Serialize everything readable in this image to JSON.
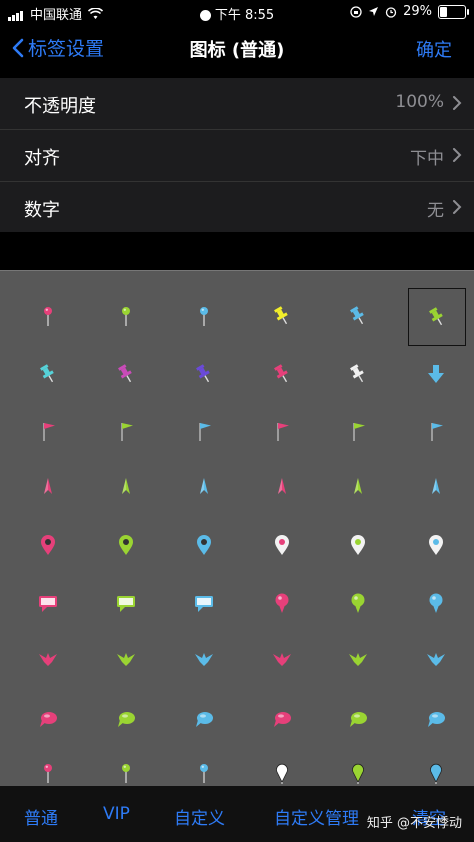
{
  "status_bar": {
    "carrier": "中国联通",
    "time": "下午 8:55",
    "battery": "29%",
    "battery_level": 0.29
  },
  "nav": {
    "back_label": "标签设置",
    "title": "图标 (普通)",
    "confirm_label": "确定"
  },
  "settings": [
    {
      "label": "不透明度",
      "value": "100%"
    },
    {
      "label": "对齐",
      "value": "下中"
    },
    {
      "label": "数字",
      "value": "无"
    }
  ],
  "icons": [
    [
      "pin-red-icon",
      "pin-green-icon",
      "pin-blue-icon",
      "pushpin-yellow-icon",
      "pushpin-blue-icon",
      "pushpin-green-icon"
    ],
    [
      "pushpin-cyan-icon",
      "pushpin-magenta-icon",
      "pushpin-purple-icon",
      "pushpin-red-icon",
      "pushpin-white-icon",
      "arrow-down-icon"
    ],
    [
      "flag-red-icon",
      "flag-green-icon",
      "flag-blue-icon",
      "flag-red-icon",
      "flag-green-icon",
      "flag-blue-icon"
    ],
    [
      "spike-red-icon",
      "spike-green-icon",
      "spike-blue-icon",
      "spike-red-icon",
      "spike-green-icon",
      "spike-blue-icon"
    ],
    [
      "map-marker-red-icon",
      "map-marker-green-icon",
      "map-marker-blue-icon",
      "map-marker-red-white-icon",
      "map-marker-green-white-icon",
      "map-marker-blue-white-icon"
    ],
    [
      "speech-box-red-icon",
      "speech-box-green-icon",
      "speech-box-blue-icon",
      "balloon-pin-red-icon",
      "balloon-pin-green-icon",
      "balloon-pin-blue-icon"
    ],
    [
      "bird-red-icon",
      "bird-green-icon",
      "bird-blue-icon",
      "bird-red-icon",
      "bird-green-icon",
      "bird-blue-icon"
    ],
    [
      "bubble-red-icon",
      "bubble-green-icon",
      "bubble-blue-icon",
      "bubble-red-icon",
      "bubble-green-icon",
      "bubble-blue-icon"
    ],
    [
      "needle-red-icon",
      "needle-green-icon",
      "needle-blue-icon",
      "drop-pin-white-icon",
      "drop-pin-green-icon",
      "drop-pin-blue-icon"
    ]
  ],
  "selected_icon": "pushpin-green-icon",
  "tabs": [
    "普通",
    "VIP",
    "自定义",
    "自定义管理",
    "清空"
  ],
  "watermark": "知乎 @不安悸动",
  "colors": {
    "accent": "#2e7bf6",
    "red": "#e6407a",
    "green": "#9ad432",
    "blue": "#5bbbe8",
    "yellow": "#f2ee2a",
    "violet": "#6a4ad8",
    "magenta": "#c94bb8",
    "cyan": "#56d2d8",
    "grid_bg": "#585858"
  }
}
